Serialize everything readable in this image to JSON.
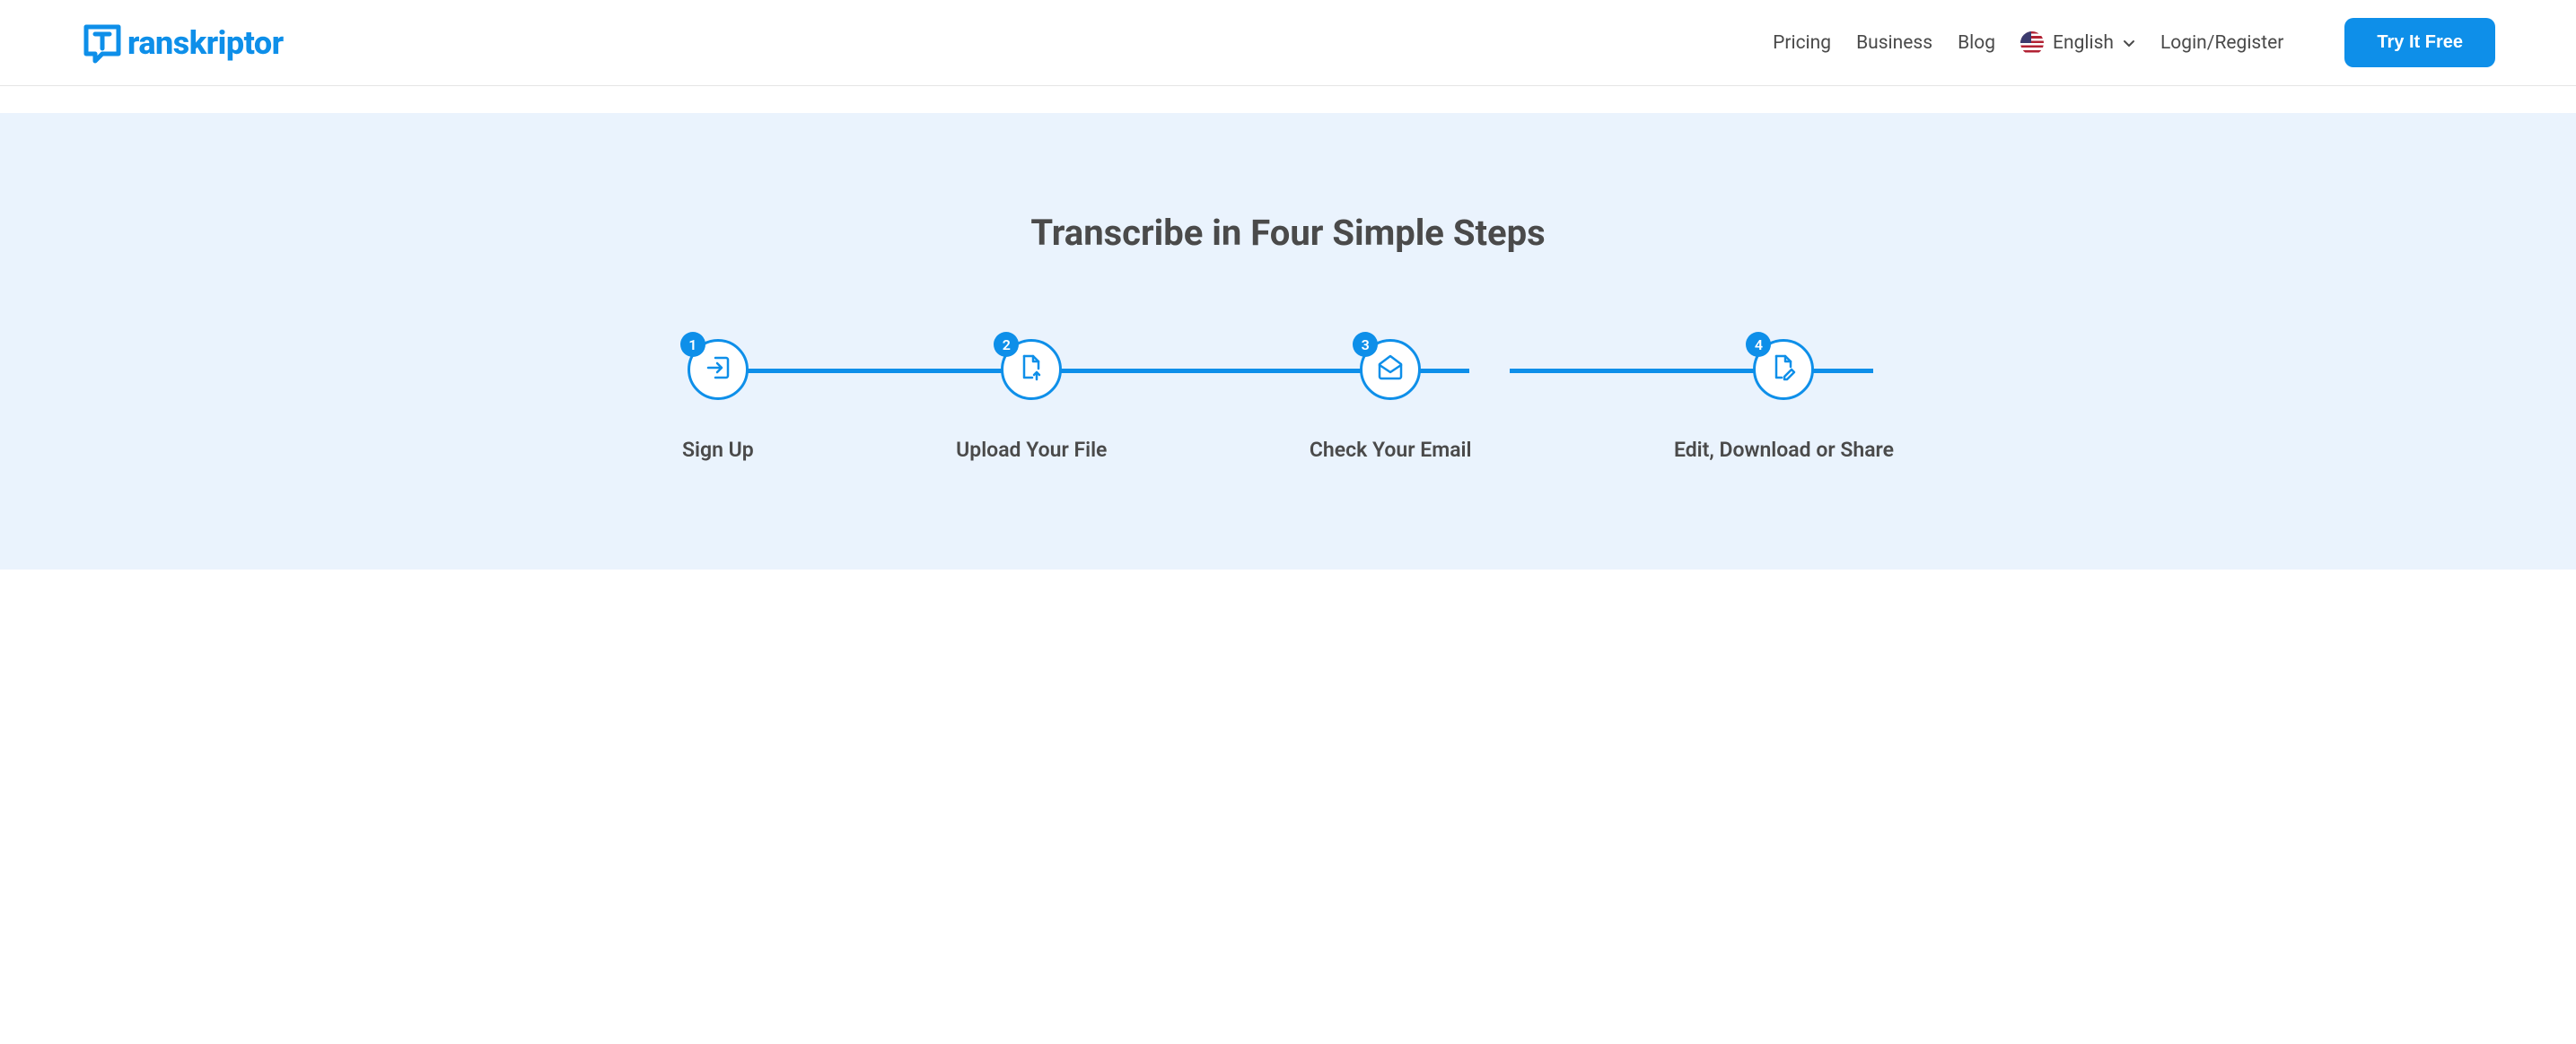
{
  "header": {
    "logo_text": "ranskriptor",
    "nav": {
      "pricing": "Pricing",
      "business": "Business",
      "blog": "Blog",
      "language": "English",
      "login": "Login/Register"
    },
    "cta": "Try It Free"
  },
  "hero": {
    "title": "Transcribe in Four Simple Steps",
    "steps": [
      {
        "number": "1",
        "label": "Sign Up"
      },
      {
        "number": "2",
        "label": "Upload Your File"
      },
      {
        "number": "3",
        "label": "Check Your Email"
      },
      {
        "number": "4",
        "label": "Edit, Download or Share"
      }
    ]
  }
}
